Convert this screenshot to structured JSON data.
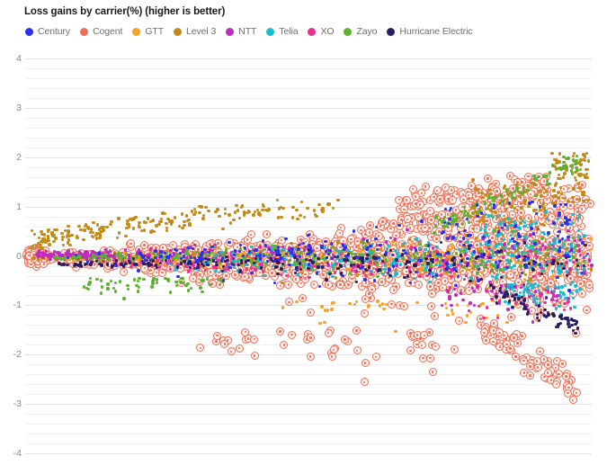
{
  "chart_data": {
    "type": "scatter",
    "title": "Loss gains by carrier(%) (higher is better)",
    "xlabel": "",
    "ylabel": "",
    "ylim": [
      -4,
      4
    ],
    "yticks": [
      "4",
      "3",
      "2",
      "1",
      "0",
      "-1",
      "-2",
      "-3",
      "-4"
    ],
    "grid": true,
    "minor_gridlines_per_major": 4,
    "zero_line": true,
    "legend_position": "top",
    "xaxis_visible": false,
    "series": [
      {
        "name": "Century",
        "color": "#2b31f0",
        "marker": "dot",
        "points": [
          [
            0.075,
            -0.04
          ],
          [
            0.09,
            0.02
          ],
          [
            0.11,
            -0.12
          ],
          [
            0.13,
            0.05
          ],
          [
            0.16,
            -0.2
          ],
          [
            0.2,
            -0.3
          ],
          [
            0.23,
            0.1
          ],
          [
            0.27,
            -0.42
          ],
          [
            0.3,
            -0.25
          ],
          [
            0.33,
            0.18
          ],
          [
            0.35,
            -0.5
          ],
          [
            0.38,
            0.22
          ],
          [
            0.4,
            -0.35
          ],
          [
            0.42,
            0.3
          ],
          [
            0.44,
            -0.55
          ],
          [
            0.46,
            0.35
          ],
          [
            0.48,
            -0.28
          ],
          [
            0.5,
            0.42
          ],
          [
            0.52,
            -0.62
          ],
          [
            0.54,
            0.25
          ],
          [
            0.56,
            -0.4
          ],
          [
            0.58,
            0.5
          ],
          [
            0.6,
            -0.48
          ],
          [
            0.62,
            0.58
          ],
          [
            0.64,
            -0.35
          ],
          [
            0.66,
            0.62
          ],
          [
            0.68,
            -0.55
          ],
          [
            0.7,
            0.7
          ],
          [
            0.72,
            -0.42
          ],
          [
            0.74,
            0.68
          ],
          [
            0.76,
            -0.6
          ],
          [
            0.78,
            0.75
          ],
          [
            0.8,
            -0.5
          ],
          [
            0.82,
            0.3
          ],
          [
            0.84,
            -0.75
          ],
          [
            0.86,
            0.35
          ],
          [
            0.88,
            -0.58
          ],
          [
            0.9,
            0.25
          ],
          [
            0.92,
            -0.85
          ],
          [
            0.94,
            0.4
          ],
          [
            0.96,
            -0.7
          ],
          [
            0.98,
            0.33
          ]
        ]
      },
      {
        "name": "Cogent",
        "color": "#f26d54",
        "marker": "ring",
        "points": []
      },
      {
        "name": "GTT",
        "color": "#f7a227",
        "marker": "dot",
        "points": []
      },
      {
        "name": "Level 3",
        "color": "#c28a16",
        "marker": "dot",
        "points": []
      },
      {
        "name": "NTT",
        "color": "#c02ac0",
        "marker": "dot",
        "points": []
      },
      {
        "name": "Telia",
        "color": "#15bcd4",
        "marker": "dot",
        "points": []
      },
      {
        "name": "XO",
        "color": "#eb3192",
        "marker": "dot",
        "points": []
      },
      {
        "name": "Zayo",
        "color": "#5db130",
        "marker": "dot",
        "points": []
      },
      {
        "name": "Hurricane Electric",
        "color": "#2b1d63",
        "marker": "dot",
        "points": []
      }
    ],
    "description": "Dense scatter of per-carrier loss gain percentages; values fan out from near 0 at the left edge to roughly +2 and -3 at the right edge. Cogent (salmon ring markers) dominates the distribution."
  }
}
